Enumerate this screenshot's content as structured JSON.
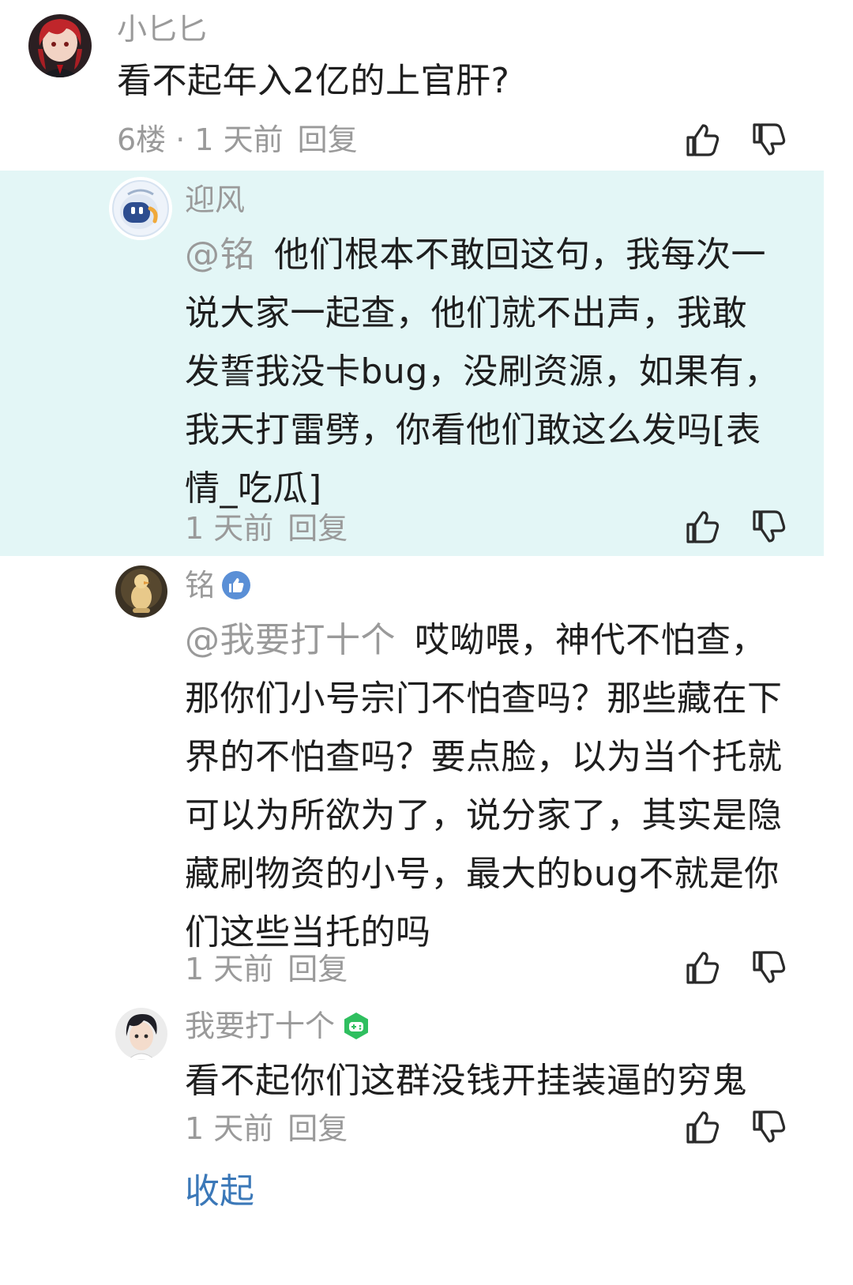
{
  "comments": [
    {
      "username": "小匕匕",
      "content": "看不起年入2亿的上官肝?",
      "meta": "6楼 · 1 天前",
      "reply_label": "回复",
      "avatar": "red-hair-character-avatar"
    },
    {
      "username": "迎风",
      "mention": "@铭",
      "content": "他们根本不敢回这句，我每次一说大家一起查，他们就不出声，我敢发誓我没卡bug，没刷资源，如果有，我天打雷劈，你看他们敢这么发吗[表情_吃瓜]",
      "meta": "1 天前",
      "reply_label": "回复",
      "avatar": "robot-avatar",
      "highlighted": true
    },
    {
      "username": "铭",
      "mention": "@我要打十个",
      "content": "哎呦喂，神代不怕查，那你们小号宗门不怕查吗？那些藏在下界的不怕查吗？要点脸，以为当个托就可以为所欲为了，说分家了，其实是隐藏刷物资的小号，最大的bug不就是你们这些当托的吗",
      "meta": "1 天前",
      "reply_label": "回复",
      "avatar": "duck-figure-avatar",
      "badge": "thumbs-up-badge-icon"
    },
    {
      "username": "我要打十个",
      "content": "看不起你们这群没钱开挂装逼的穷鬼",
      "meta": "1 天前",
      "reply_label": "回复",
      "avatar": "dark-hair-character-avatar",
      "badge": "gamepad-badge-icon"
    }
  ],
  "collapse_label": "收起",
  "colors": {
    "highlight_bg": "#e3f6f6",
    "link": "#3b78b8",
    "muted": "#9a9a9a",
    "text": "#1e1e1e"
  }
}
